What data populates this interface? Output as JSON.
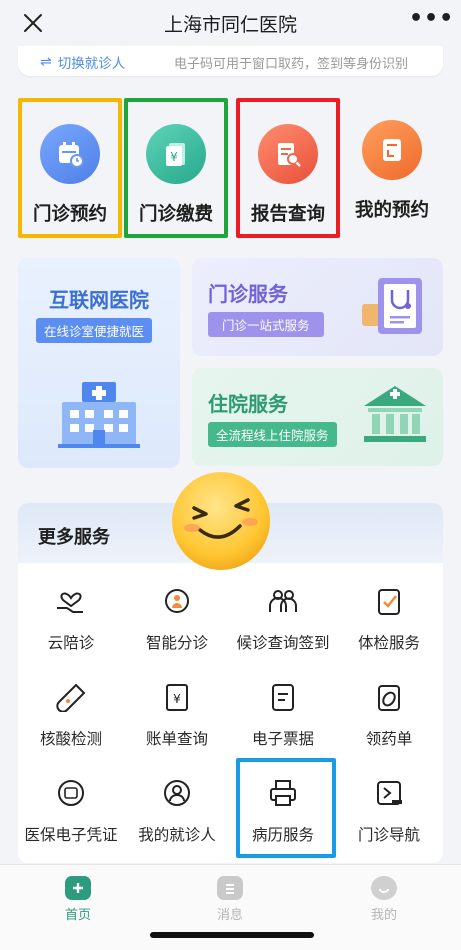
{
  "header": {
    "title": "上海市同仁医院",
    "close_icon": "close-icon",
    "more_label": "•••"
  },
  "patient_bar": {
    "switch_label": "切换就诊人",
    "note": "电子码可用于窗口取药，签到等身份识别"
  },
  "quick_actions": [
    {
      "label": "门诊预约",
      "icon": "calendar-clock-icon",
      "color": "#5b8ef0",
      "highlight": "#f5b800"
    },
    {
      "label": "门诊缴费",
      "icon": "yuan-payment-icon",
      "color": "#2fb39a",
      "highlight": "#1fa53a"
    },
    {
      "label": "报告查询",
      "icon": "report-search-icon",
      "color": "#f0664a",
      "highlight": "#ec1c24"
    },
    {
      "label": "我的预约",
      "icon": "my-appointment-icon",
      "color": "#f47b3c",
      "highlight": ""
    }
  ],
  "cards": {
    "internet": {
      "title": "互联网医院",
      "tag": "在线诊室便捷就医",
      "icon": "hospital-building-icon"
    },
    "outpatient": {
      "title": "门诊服务",
      "tag": "门诊一站式服务",
      "icon": "stethoscope-clipboard-icon"
    },
    "inpatient": {
      "title": "住院服务",
      "tag": "全流程线上住院服务",
      "icon": "hospital-bank-icon"
    }
  },
  "more_services": {
    "title": "更多服务",
    "items": [
      {
        "label": "云陪诊",
        "icon": "heart-hand-icon"
      },
      {
        "label": "智能分诊",
        "icon": "smart-triage-icon"
      },
      {
        "label": "候诊查询签到",
        "icon": "waiting-checkin-icon"
      },
      {
        "label": "体检服务",
        "icon": "checkup-icon"
      },
      {
        "label": "核酸检测",
        "icon": "test-tube-icon"
      },
      {
        "label": "账单查询",
        "icon": "bill-icon"
      },
      {
        "label": "电子票据",
        "icon": "e-receipt-icon"
      },
      {
        "label": "领药单",
        "icon": "medicine-slip-icon"
      },
      {
        "label": "医保电子凭证",
        "icon": "insurance-card-icon"
      },
      {
        "label": "我的就诊人",
        "icon": "user-circle-icon"
      },
      {
        "label": "病历服务",
        "icon": "printer-icon"
      },
      {
        "label": "门诊导航",
        "icon": "navigation-icon"
      }
    ],
    "highlighted_item": "病历服务",
    "highlight_color": "#1a9be8"
  },
  "tabs": [
    {
      "label": "首页",
      "icon": "home-icon",
      "active": true
    },
    {
      "label": "消息",
      "icon": "message-icon",
      "active": false
    },
    {
      "label": "我的",
      "icon": "profile-icon",
      "active": false
    }
  ],
  "overlay": {
    "icon": "smiling-emoji-icon"
  },
  "colors": {
    "accent": "#4d8de8",
    "active_tab": "#2d9b7e"
  }
}
